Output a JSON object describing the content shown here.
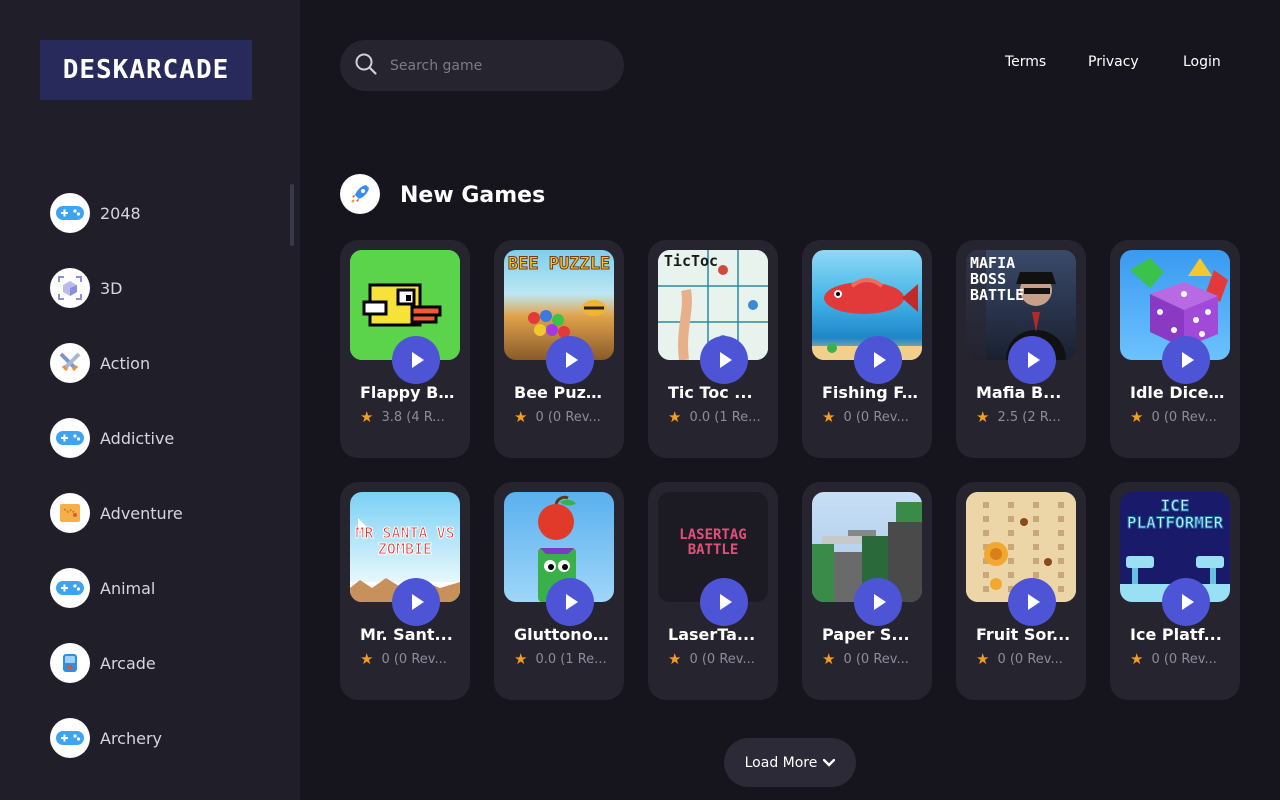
{
  "brand": {
    "logo_text": "DESKARCADE"
  },
  "search": {
    "placeholder": "Search game"
  },
  "nav": {
    "terms": "Terms",
    "privacy": "Privacy",
    "login": "Login"
  },
  "sidebar": {
    "items": [
      {
        "label": "2048",
        "icon": "gamepad-icon"
      },
      {
        "label": "3D",
        "icon": "cube-icon"
      },
      {
        "label": "Action",
        "icon": "swords-icon"
      },
      {
        "label": "Addictive",
        "icon": "gamepad-icon"
      },
      {
        "label": "Adventure",
        "icon": "map-icon"
      },
      {
        "label": "Animal",
        "icon": "gamepad-icon"
      },
      {
        "label": "Arcade",
        "icon": "arcade-icon"
      },
      {
        "label": "Archery",
        "icon": "gamepad-icon"
      }
    ]
  },
  "section": {
    "title": "New Games",
    "icon": "rocket-icon"
  },
  "games": [
    {
      "title": "Flappy B...",
      "rating": "3.8 (4 R...",
      "thumb": "flappy-bird"
    },
    {
      "title": "Bee Puzz...",
      "rating": "0 (0 Rev...",
      "thumb": "bee-puzzle",
      "thumb_text": "BEE PUZZLE"
    },
    {
      "title": "Tic Toc ...",
      "rating": "0.0 (1 Re...",
      "thumb": "tic-toc",
      "thumb_text": "TicToc"
    },
    {
      "title": "Fishing F...",
      "rating": "0 (0 Rev...",
      "thumb": "fishing"
    },
    {
      "title": "Mafia B...",
      "rating": "2.5 (2 R...",
      "thumb": "mafia-boss",
      "thumb_text": "MAFIA BOSS BATTLE"
    },
    {
      "title": "Idle Dice...",
      "rating": "0 (0 Rev...",
      "thumb": "idle-dice"
    },
    {
      "title": "Mr. Sant...",
      "rating": "0 (0 Rev...",
      "thumb": "mr-santa",
      "thumb_text": "MR SANTA VS ZOMBIE"
    },
    {
      "title": "Gluttono...",
      "rating": "0.0 (1 Re...",
      "thumb": "gluttonous"
    },
    {
      "title": "LaserTa...",
      "rating": "0 (0 Rev...",
      "thumb": "lasertag",
      "thumb_text": "LASERTAG BATTLE"
    },
    {
      "title": "Paper S...",
      "rating": "0 (0 Rev...",
      "thumb": "paper"
    },
    {
      "title": "Fruit Sor...",
      "rating": "0 (0 Rev...",
      "thumb": "fruit-sort"
    },
    {
      "title": "Ice Platf...",
      "rating": "0 (0 Rev...",
      "thumb": "ice-platformer",
      "thumb_text": "ICE PLATFORMER"
    }
  ],
  "load_more": {
    "label": "Load More"
  },
  "colors": {
    "accent": "#4d55d6",
    "star": "#f39c21",
    "background": "#16151d",
    "sidebar": "#1f1e29",
    "card": "#25242f"
  }
}
